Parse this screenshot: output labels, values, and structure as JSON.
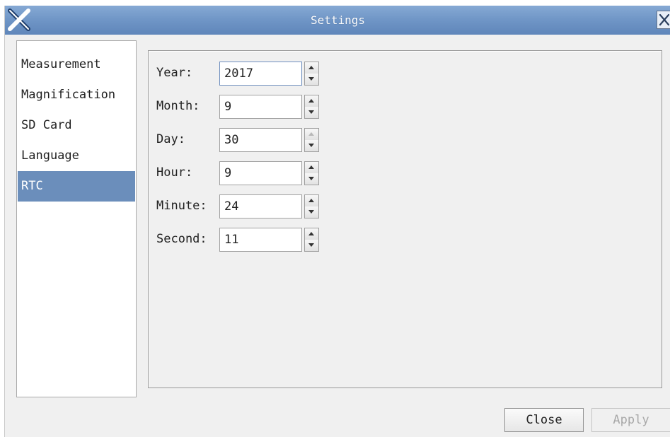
{
  "window": {
    "title": "Settings",
    "titlebar_color": "#6f95c6"
  },
  "sidebar": {
    "items": [
      {
        "label": "Measurement",
        "selected": false
      },
      {
        "label": "Magnification",
        "selected": false
      },
      {
        "label": "SD Card",
        "selected": false
      },
      {
        "label": "Language",
        "selected": false
      },
      {
        "label": "RTC",
        "selected": true
      }
    ],
    "selected_color": "#6b8ebb"
  },
  "rtc": {
    "fields": [
      {
        "label": "Year:",
        "value": "2017"
      },
      {
        "label": "Month:",
        "value": "9"
      },
      {
        "label": "Day:",
        "value": "30"
      },
      {
        "label": "Hour:",
        "value": "9"
      },
      {
        "label": "Minute:",
        "value": "24"
      },
      {
        "label": "Second:",
        "value": "11"
      }
    ]
  },
  "footer": {
    "close_label": "Close",
    "apply_label": "Apply",
    "apply_enabled": false
  },
  "icons": {
    "app": "x-logo-icon",
    "window_close": "close-icon",
    "spin_up": "triangle-up-icon",
    "spin_down": "triangle-down-icon"
  }
}
